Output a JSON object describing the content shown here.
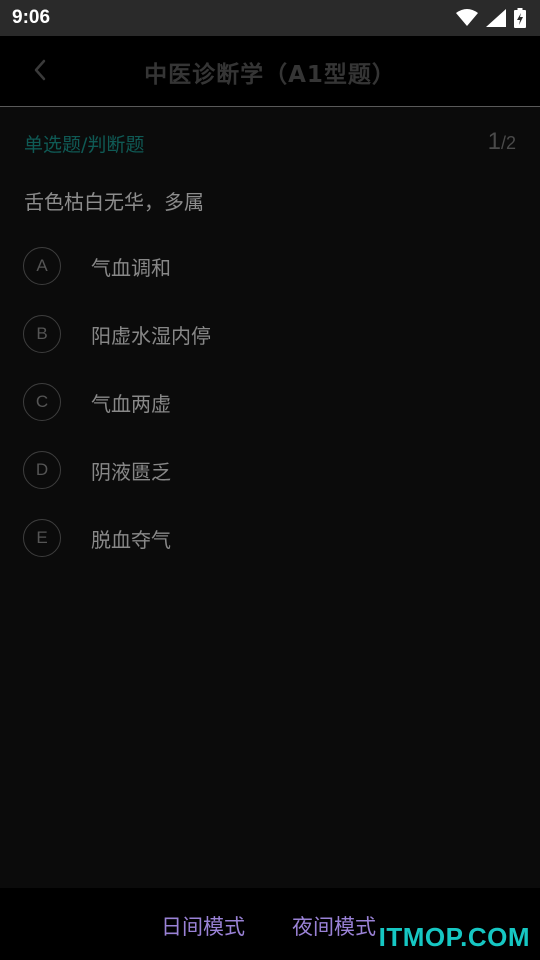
{
  "status_bar": {
    "time": "9:06",
    "icons": [
      "wifi-icon",
      "signal-icon",
      "battery-charging-icon"
    ]
  },
  "header": {
    "title": "中医诊断学（A1型题）",
    "back_icon": "chevron-left-icon"
  },
  "question": {
    "type_label": "单选题/判断题",
    "current": "1",
    "separator": "/",
    "total": "2",
    "text": "舌色枯白无华，多属",
    "options": [
      {
        "letter": "A",
        "text": "气血调和"
      },
      {
        "letter": "B",
        "text": "阳虚水湿内停"
      },
      {
        "letter": "C",
        "text": "气血两虚"
      },
      {
        "letter": "D",
        "text": "阴液匮乏"
      },
      {
        "letter": "E",
        "text": "脱血夺气"
      }
    ]
  },
  "footer": {
    "day_mode": "日间模式",
    "night_mode": "夜间模式",
    "watermark": "ITMOP.COM"
  },
  "colors": {
    "background": "#0b0b0b",
    "status_bar": "#2a2a2a",
    "type_label": "#0f5a55",
    "mode_buttons": "#9a82d6",
    "watermark": "#16c7c3"
  }
}
